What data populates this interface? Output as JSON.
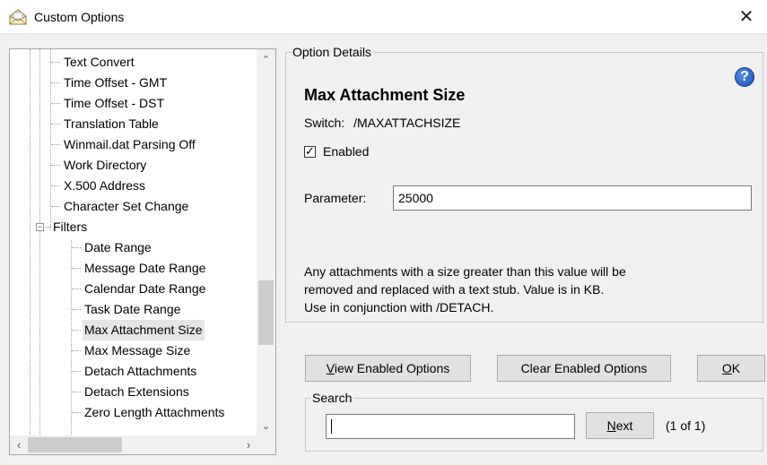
{
  "window": {
    "title": "Custom Options",
    "close_glyph": "✕",
    "icon": "envelope-app-icon"
  },
  "tree": {
    "items": [
      {
        "label": "Text Convert",
        "level": 2
      },
      {
        "label": "Time Offset - GMT",
        "level": 2
      },
      {
        "label": "Time Offset - DST",
        "level": 2
      },
      {
        "label": "Translation Table",
        "level": 2
      },
      {
        "label": "Winmail.dat Parsing Off",
        "level": 2
      },
      {
        "label": "Work Directory",
        "level": 2
      },
      {
        "label": "X.500 Address",
        "level": 2
      },
      {
        "label": "Character Set Change",
        "level": 2
      },
      {
        "label": "Filters",
        "level": 1,
        "expanded": true
      },
      {
        "label": "Date Range",
        "level": 2
      },
      {
        "label": "Message Date Range",
        "level": 2
      },
      {
        "label": "Calendar Date Range",
        "level": 2
      },
      {
        "label": "Task Date Range",
        "level": 2
      },
      {
        "label": "Max Attachment Size",
        "level": 2,
        "selected": true
      },
      {
        "label": "Max Message Size",
        "level": 2
      },
      {
        "label": "Detach Attachments",
        "level": 2
      },
      {
        "label": "Detach Extensions",
        "level": 2
      },
      {
        "label": "Zero Length Attachments",
        "level": 2
      }
    ],
    "expander_glyph": "−"
  },
  "details": {
    "group_label": "Option Details",
    "title": "Max Attachment Size",
    "switch_label": "Switch:",
    "switch_value": "/MAXATTACHSIZE",
    "enabled_label": "Enabled",
    "enabled": true,
    "check_glyph": "✓",
    "parameter_label": "Parameter:",
    "parameter_value": "25000",
    "description_lines": [
      "Any attachments with a size greater than this value will be",
      "removed and replaced with a text stub. Value is in KB.",
      "Use in conjunction with /DETACH."
    ],
    "help_glyph": "?"
  },
  "buttons": {
    "view_enabled_mnemonic": "V",
    "view_enabled_rest": "iew Enabled Options",
    "clear_enabled": "Clear Enabled Options",
    "ok_mnemonic": "O",
    "ok_rest": "K"
  },
  "search": {
    "group_label": "Search",
    "value": "",
    "next_mnemonic": "N",
    "next_rest": "ext",
    "count": "(1 of 1)"
  }
}
